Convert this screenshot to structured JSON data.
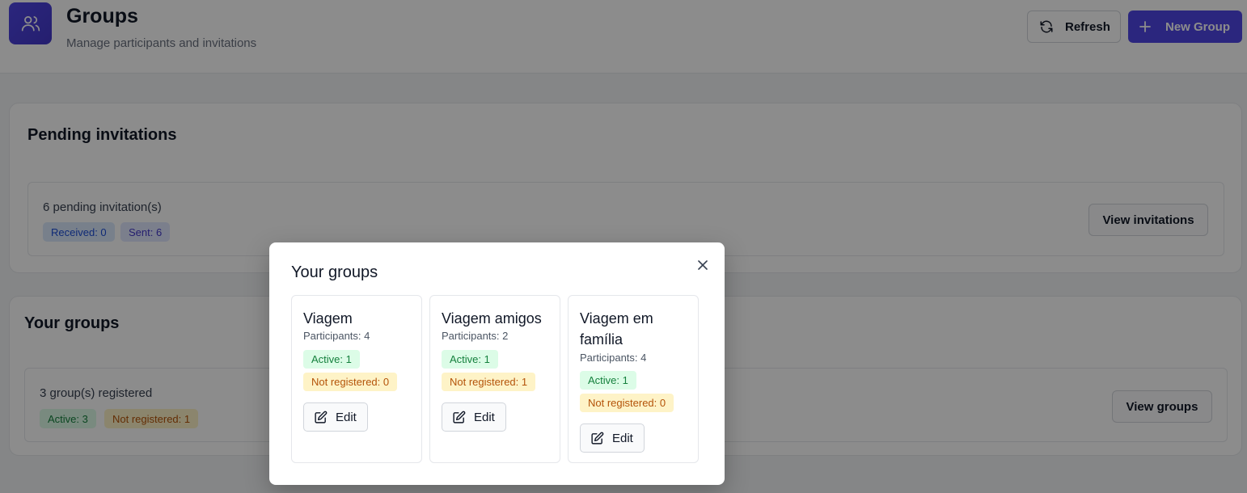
{
  "header": {
    "title": "Groups",
    "subtitle": "Manage participants and invitations",
    "refresh_label": "Refresh",
    "new_group_label": "New Group"
  },
  "pending": {
    "title": "Pending invitations",
    "summary": "6 pending invitation(s)",
    "received": "Received: 0",
    "sent": "Sent: 6",
    "view_button": "View invitations"
  },
  "groups_section": {
    "title": "Your groups",
    "summary": "3 group(s) registered",
    "active": "Active: 3",
    "not_registered": "Not registered: 1",
    "view_button": "View groups"
  },
  "modal": {
    "title": "Your groups",
    "edit_label": "Edit",
    "groups": [
      {
        "name": "Viagem",
        "participants": "Participants: 4",
        "active": "Active: 1",
        "not_registered": "Not registered: 0"
      },
      {
        "name": "Viagem amigos",
        "participants": "Participants: 2",
        "active": "Active: 1",
        "not_registered": "Not registered: 1"
      },
      {
        "name": "Viagem em família",
        "participants": "Participants: 4",
        "active": "Active: 1",
        "not_registered": "Not registered: 0"
      }
    ]
  },
  "colors": {
    "primary": "#4f46e5",
    "active_bg": "#dcfce7",
    "warning_bg": "#fef3c7"
  },
  "icons": {
    "header": "users-icon",
    "refresh": "refresh-icon",
    "new_group": "plus-icon",
    "close": "close-icon",
    "edit": "edit-icon"
  }
}
